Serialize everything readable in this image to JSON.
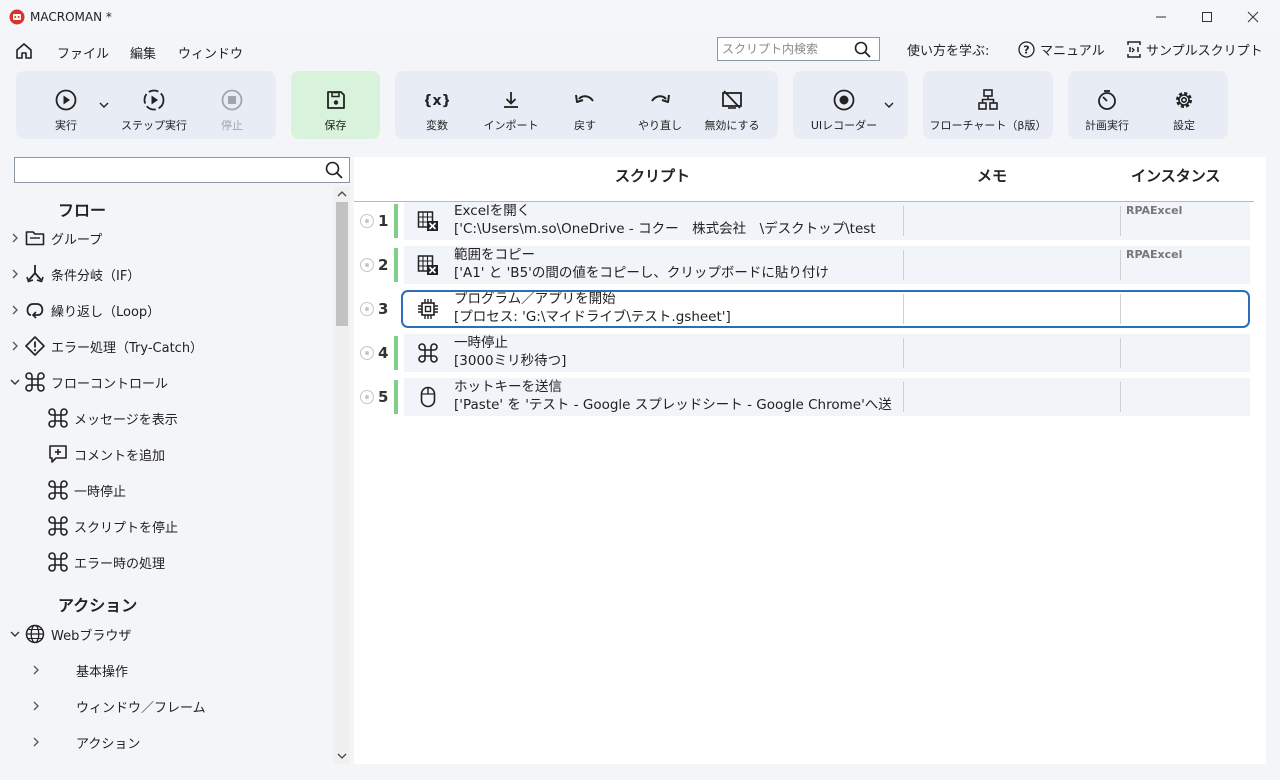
{
  "window": {
    "title": "MACROMAN *"
  },
  "menu": {
    "file": "ファイル",
    "edit": "編集",
    "window": "ウィンドウ"
  },
  "search": {
    "placeholder": "スクリプト内検索"
  },
  "help": {
    "learn": "使い方を学ぶ:",
    "manual": "マニュアル",
    "sample": "サンプルスクリプト"
  },
  "toolbar": {
    "run": "実行",
    "step_run": "ステップ実行",
    "stop": "停止",
    "save": "保存",
    "variable": "変数",
    "import": "インポート",
    "undo": "戻す",
    "redo": "やり直し",
    "disable": "無効にする",
    "ui_recorder": "UIレコーダー",
    "flowchart": "フローチャート（β版）",
    "scheduled": "計画実行",
    "settings": "設定"
  },
  "left_panel": {
    "search_placeholder": "",
    "flow_header": "フロー",
    "flow_items": [
      "グループ",
      "条件分岐（IF）",
      "繰り返し（Loop）",
      "エラー処理（Try-Catch）",
      "フローコントロール"
    ],
    "flow_control_children": [
      "メッセージを表示",
      "コメントを追加",
      "一時停止",
      "スクリプトを停止",
      "エラー時の処理"
    ],
    "action_header": "アクション",
    "action_items": [
      "Webブラウザ"
    ],
    "web_children": [
      "基本操作",
      "ウィンドウ／フレーム",
      "アクション"
    ]
  },
  "script_table": {
    "columns": {
      "script": "スクリプト",
      "memo": "メモ",
      "instance": "インスタンス"
    },
    "rows": [
      {
        "num": "1",
        "title": "Excelを開く",
        "detail": "['C:\\Users\\m.so\\OneDrive - コクー　株式会社　\\デスクトップ\\test",
        "memo": "",
        "instance": "RPAExcel",
        "icon": "excel-icon"
      },
      {
        "num": "2",
        "title": "範囲をコピー",
        "detail": "['A1' と 'B5'の間の値をコピーし、クリップボードに貼り付け",
        "memo": "",
        "instance": "RPAExcel",
        "icon": "excel-icon"
      },
      {
        "num": "3",
        "title": "プログラム／アプリを開始",
        "detail": "[プロセス: 'G:\\マイドライブ\\テスト.gsheet']",
        "memo": "",
        "instance": "",
        "icon": "chip-icon"
      },
      {
        "num": "4",
        "title": "一時停止",
        "detail": "[3000ミリ秒待つ]",
        "memo": "",
        "instance": "",
        "icon": "command-icon"
      },
      {
        "num": "5",
        "title": "ホットキーを送信",
        "detail": "['Paste' を 'テスト - Google スプレッドシート - Google Chrome'へ送",
        "memo": "",
        "instance": "",
        "icon": "mouse-icon"
      }
    ]
  }
}
